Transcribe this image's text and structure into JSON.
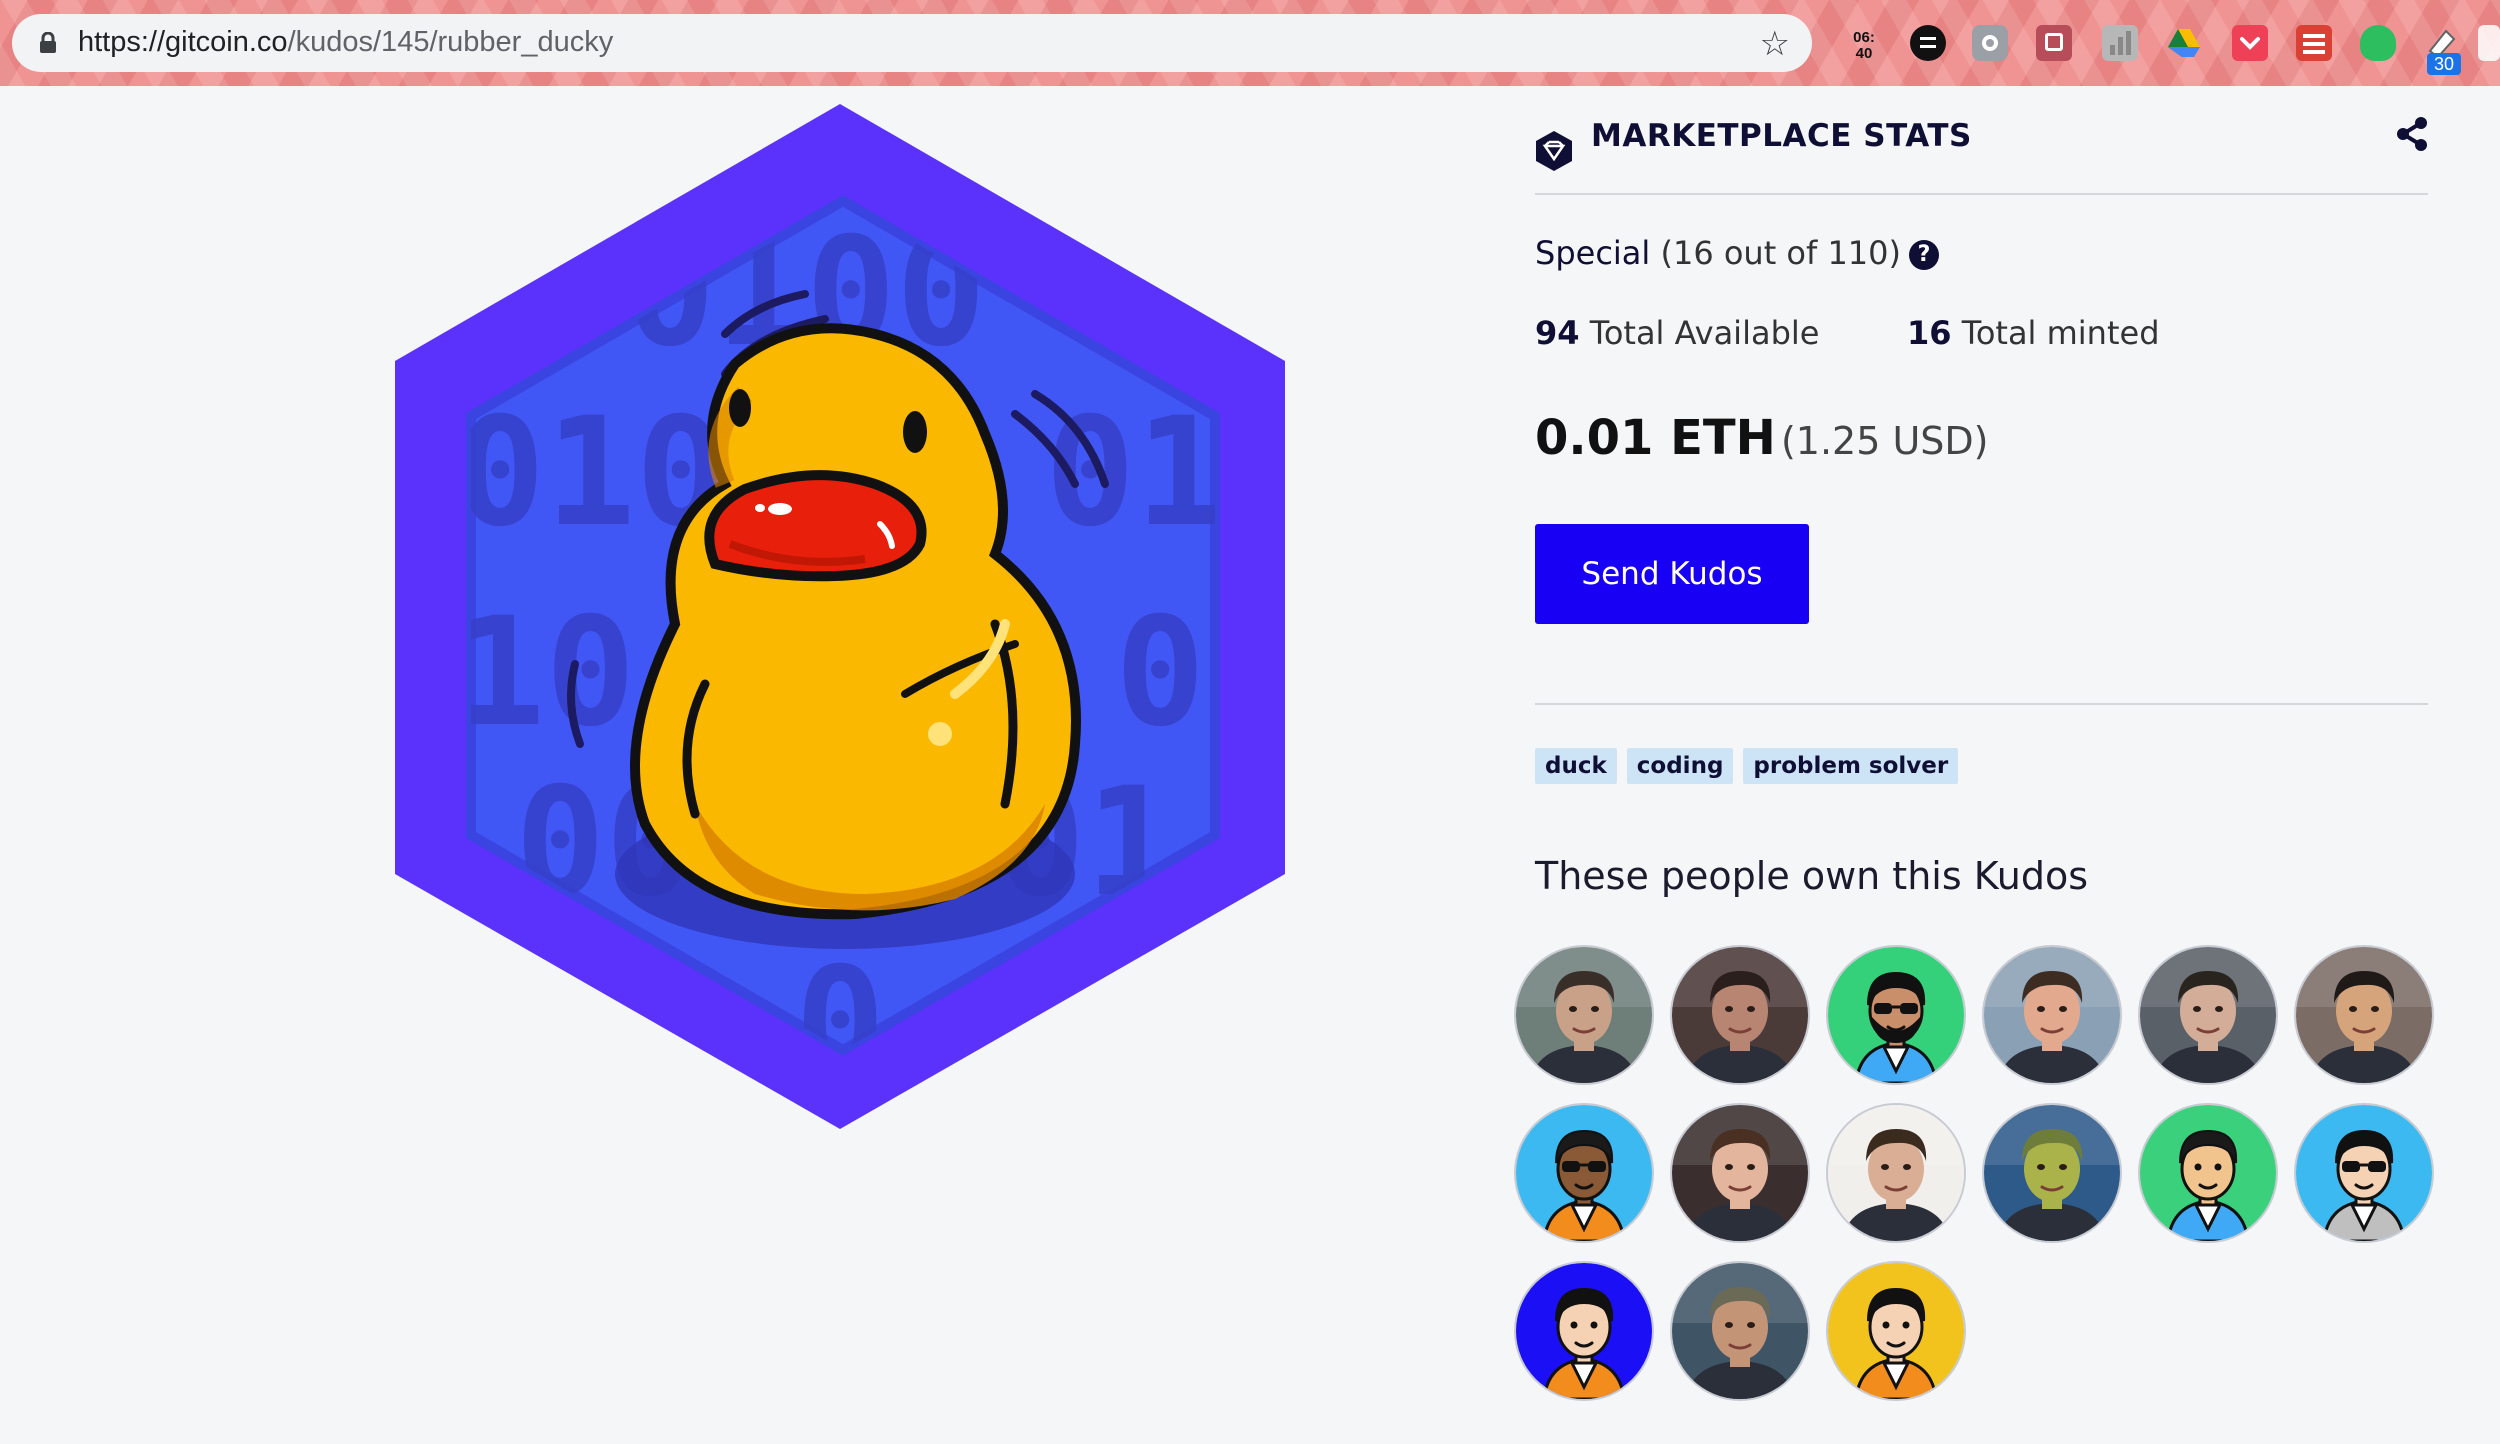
{
  "browser": {
    "url_host": "https://gitcoin.co",
    "url_path": "/kudos/145/rubber_ducky",
    "clock_top": "06:",
    "clock_bottom": "40",
    "badge_count": "30"
  },
  "kudos": {
    "art_alt": "rubber ducky",
    "binary_digits": [
      "0100",
      "010",
      "010",
      "10",
      "0",
      "00",
      "01",
      "0"
    ]
  },
  "stats": {
    "title": "MARKETPLACE STATS",
    "rarity_level": "Special",
    "rarity_detail": " (16 out of 110)",
    "available_count": "94",
    "available_label": " Total Available",
    "minted_count": "16",
    "minted_label": " Total minted",
    "price_eth": "0.01 ETH",
    "price_usd": "(1.25 USD)",
    "send_label": "Send Kudos"
  },
  "tags": [
    "duck",
    "coding",
    "problem solver"
  ],
  "owners": {
    "title": "These people own this Kudos",
    "avatars": [
      {
        "kind": "photo",
        "bg": "#6e7f7a",
        "skin": "#c9a088",
        "hair": "#3a2e28"
      },
      {
        "kind": "photo",
        "bg": "#4a3a38",
        "skin": "#b78572",
        "hair": "#2a1f1c"
      },
      {
        "kind": "cartoon",
        "bg": "#34d17a",
        "skin": "#c98f6a",
        "hair": "#111111",
        "shirt": "#3fa9f5",
        "glasses": true,
        "beard": true
      },
      {
        "kind": "photo",
        "bg": "#8aa0b4",
        "skin": "#e3a98f",
        "hair": "#3d2c22"
      },
      {
        "kind": "photo",
        "bg": "#5a6068",
        "skin": "#d3ad98",
        "hair": "#2a241f"
      },
      {
        "kind": "photo",
        "bg": "#7b6d66",
        "skin": "#d6a47a",
        "hair": "#1f1a18"
      },
      {
        "kind": "cartoon",
        "bg": "#3cb9f0",
        "skin": "#8a5a36",
        "hair": "#1a1a1a",
        "shirt": "#f28c1c",
        "glasses": true,
        "beard": false
      },
      {
        "kind": "photo",
        "bg": "#3b2e2e",
        "skin": "#e2b59c",
        "hair": "#4a3022"
      },
      {
        "kind": "photo",
        "bg": "#f1efec",
        "skin": "#d9ae95",
        "hair": "#3b2a1e"
      },
      {
        "kind": "photo",
        "bg": "#2e5a8a",
        "skin": "#a9b34a",
        "hair": "#6f7d3b"
      },
      {
        "kind": "cartoon",
        "bg": "#3ad07c",
        "skin": "#f1c48e",
        "hair": "#1a1a1a",
        "shirt": "#3fa9f5",
        "glasses": false,
        "beard": false
      },
      {
        "kind": "cartoon",
        "bg": "#3cb9f0",
        "skin": "#f6d2b4",
        "hair": "#111111",
        "shirt": "#bfbfbf",
        "glasses": true,
        "beard": false
      },
      {
        "kind": "cartoon",
        "bg": "#1a0ff5",
        "skin": "#f6d2b4",
        "hair": "#111111",
        "shirt": "#f28c1c",
        "glasses": false,
        "beard": false
      },
      {
        "kind": "photo",
        "bg": "#3f5566",
        "skin": "#c49477",
        "hair": "#6b6a57"
      },
      {
        "kind": "cartoon",
        "bg": "#f2c21d",
        "skin": "#f6d2b4",
        "hair": "#111111",
        "shirt": "#f28c1c",
        "glasses": false,
        "beard": false
      }
    ]
  },
  "colors": {
    "brand_blue": "#1800f5",
    "hex_outer": "#5a32fb",
    "hex_inner": "#4157f5",
    "navy": "#0f0e35",
    "tag_bg": "#cde4f6",
    "duck_yellow": "#fbb800",
    "beak_red": "#e81f0a"
  }
}
